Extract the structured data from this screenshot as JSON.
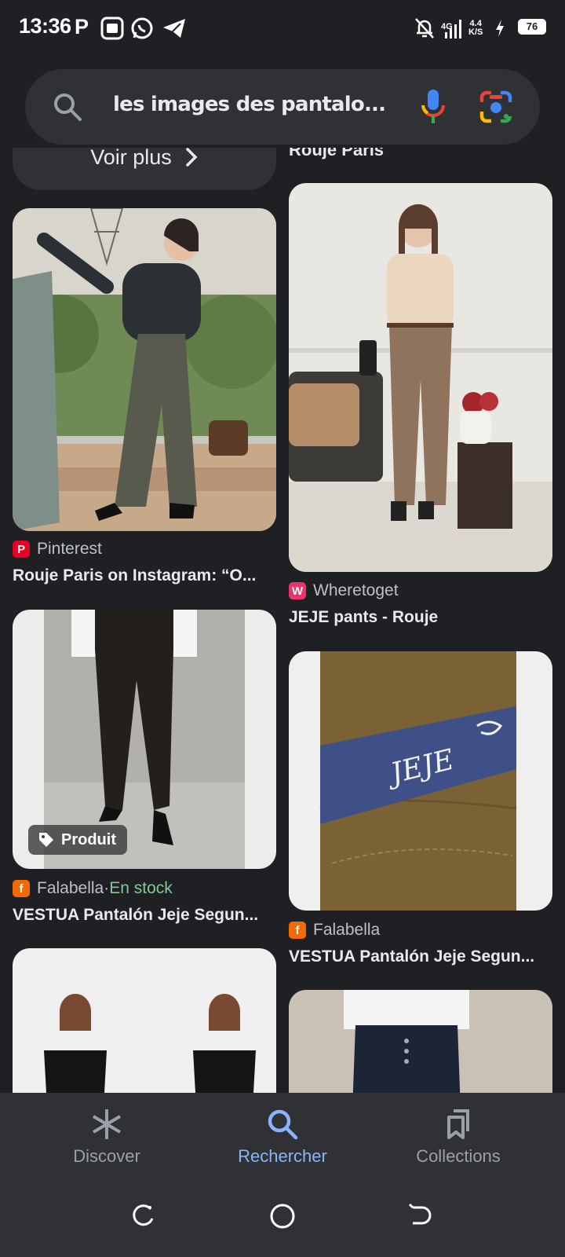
{
  "status_bar": {
    "time": "13:36",
    "network_gen": "4G",
    "speed_value": "4.4",
    "speed_unit": "K/S",
    "battery": "76"
  },
  "search": {
    "query": "les images des pantalo..."
  },
  "results": {
    "more_label": "Voir plus",
    "cut_title": "Rouje Paris",
    "items": [
      {
        "source": "Pinterest",
        "title": "Rouje Paris on Instagram: “O...",
        "badge_color": "#e60023"
      },
      {
        "source": "Wheretoget",
        "title": "JEJE pants - Rouje",
        "badge_color": "#e8336b"
      },
      {
        "source": "Falabella",
        "stock": "En stock",
        "separator": " · ",
        "title": "VESTUA Pantalón Jeje Segun...",
        "chip": "Produit",
        "badge_color": "#f56a00"
      },
      {
        "source": "Falabella",
        "title": "VESTUA Pantalón Jeje Segun...",
        "badge_color": "#f56a00"
      }
    ]
  },
  "bottom_nav": {
    "discover": "Discover",
    "search": "Rechercher",
    "collections": "Collections"
  },
  "label_text": "JEJE"
}
